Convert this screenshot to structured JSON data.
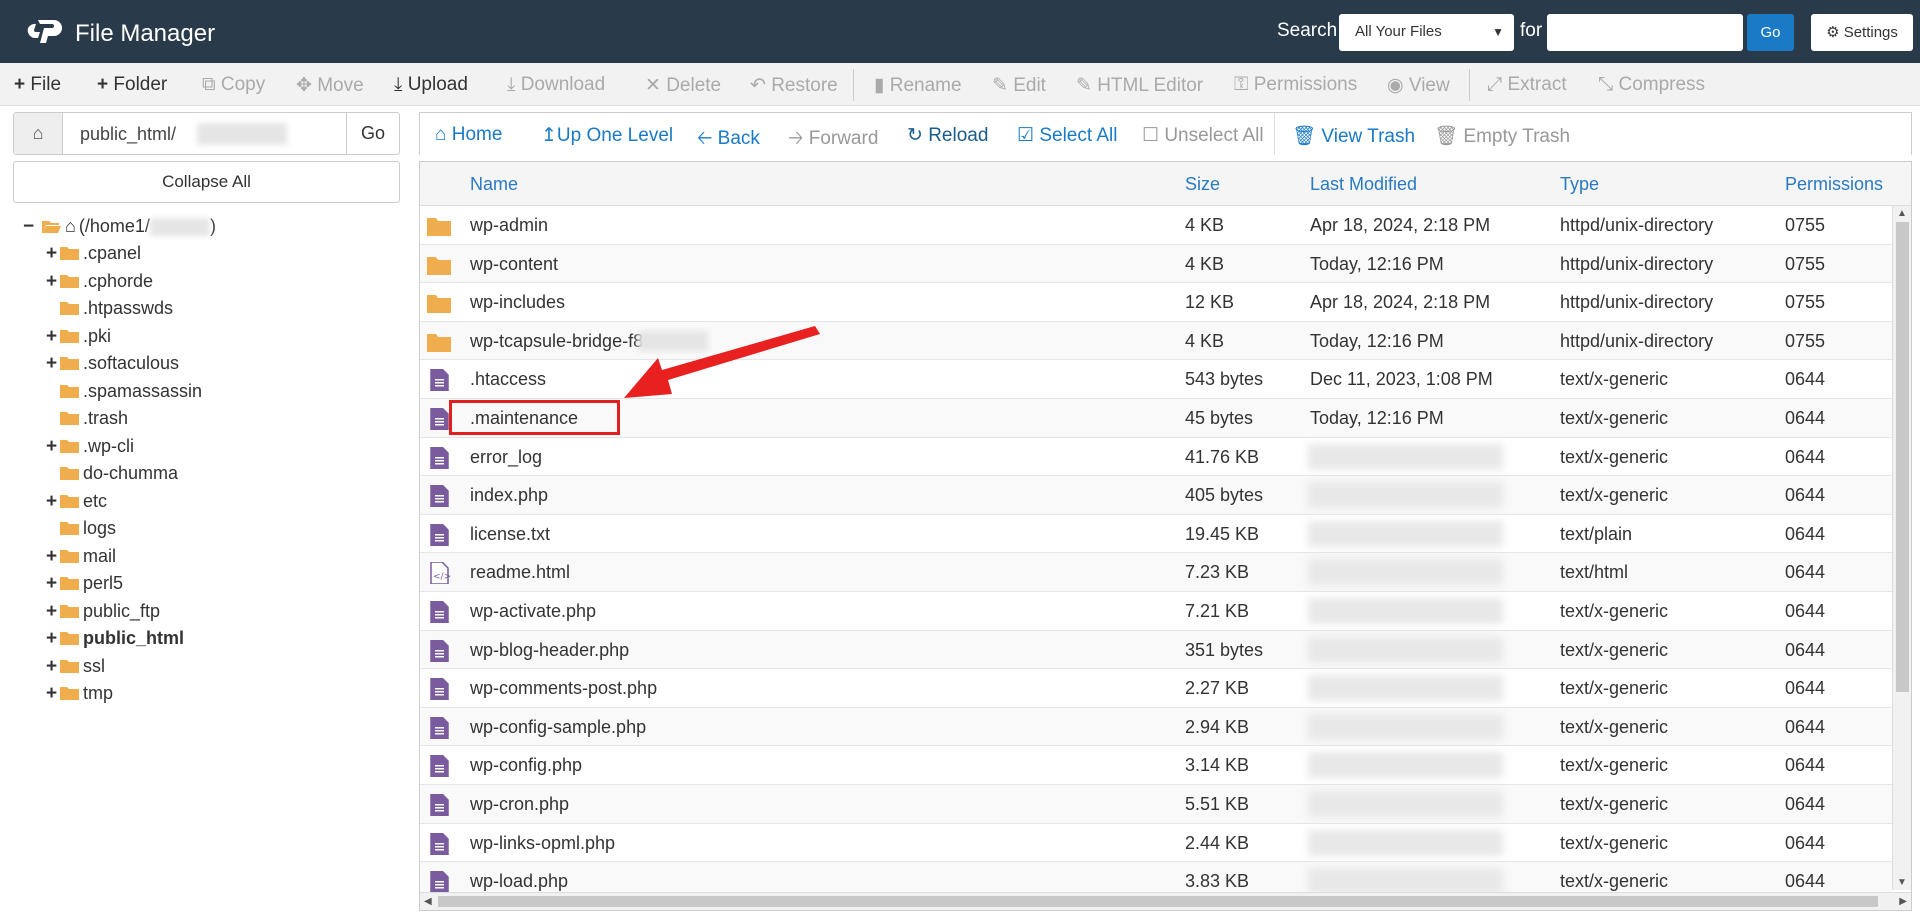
{
  "header": {
    "title": "File Manager",
    "search_label": "Search",
    "search_scope": "All Your Files",
    "for_label": "for",
    "search_value": "",
    "go_label": "Go",
    "settings_label": "Settings"
  },
  "toolbar": {
    "file": "File",
    "folder": "Folder",
    "copy": "Copy",
    "move": "Move",
    "upload": "Upload",
    "download": "Download",
    "delete": "Delete",
    "restore": "Restore",
    "rename": "Rename",
    "edit": "Edit",
    "html_editor": "HTML Editor",
    "permissions": "Permissions",
    "view": "View",
    "extract": "Extract",
    "compress": "Compress"
  },
  "sidebar": {
    "path_value": "public_html/",
    "go_label": "Go",
    "collapse_label": "Collapse All",
    "root_label_prefix": "(/home1/",
    "root_label_suffix": ")",
    "items": [
      {
        "label": ".cpanel",
        "expandable": true,
        "bold": false
      },
      {
        "label": ".cphorde",
        "expandable": true,
        "bold": false
      },
      {
        "label": ".htpasswds",
        "expandable": false,
        "bold": false
      },
      {
        "label": ".pki",
        "expandable": true,
        "bold": false
      },
      {
        "label": ".softaculous",
        "expandable": true,
        "bold": false
      },
      {
        "label": ".spamassassin",
        "expandable": false,
        "bold": false
      },
      {
        "label": ".trash",
        "expandable": false,
        "bold": false
      },
      {
        "label": ".wp-cli",
        "expandable": true,
        "bold": false
      },
      {
        "label": "do-chumma",
        "expandable": false,
        "bold": false
      },
      {
        "label": "etc",
        "expandable": true,
        "bold": false
      },
      {
        "label": "logs",
        "expandable": false,
        "bold": false
      },
      {
        "label": "mail",
        "expandable": true,
        "bold": false
      },
      {
        "label": "perl5",
        "expandable": true,
        "bold": false
      },
      {
        "label": "public_ftp",
        "expandable": true,
        "bold": false
      },
      {
        "label": "public_html",
        "expandable": true,
        "bold": true
      },
      {
        "label": "ssl",
        "expandable": true,
        "bold": false
      },
      {
        "label": "tmp",
        "expandable": true,
        "bold": false
      }
    ]
  },
  "navbar": {
    "home": "Home",
    "up_one_level": "Up One Level",
    "back": "Back",
    "forward": "Forward",
    "reload": "Reload",
    "select_all": "Select All",
    "unselect_all": "Unselect All",
    "view_trash": "View Trash",
    "empty_trash": "Empty Trash"
  },
  "table": {
    "columns": {
      "name": "Name",
      "size": "Size",
      "modified": "Last Modified",
      "type": "Type",
      "permissions": "Permissions"
    },
    "rows": [
      {
        "icon": "folder",
        "name": "wp-admin",
        "size": "4 KB",
        "modified": "Apr 18, 2024, 2:18 PM",
        "type": "httpd/unix-directory",
        "perms": "0755"
      },
      {
        "icon": "folder",
        "name": "wp-content",
        "size": "4 KB",
        "modified": "Today, 12:16 PM",
        "type": "httpd/unix-directory",
        "perms": "0755"
      },
      {
        "icon": "folder",
        "name": "wp-includes",
        "size": "12 KB",
        "modified": "Apr 18, 2024, 2:18 PM",
        "type": "httpd/unix-directory",
        "perms": "0755"
      },
      {
        "icon": "folder",
        "name": "wp-tcapsule-bridge-f8",
        "size": "4 KB",
        "modified": "Today, 12:16 PM",
        "type": "httpd/unix-directory",
        "perms": "0755"
      },
      {
        "icon": "file",
        "name": ".htaccess",
        "size": "543 bytes",
        "modified": "Dec 11, 2023, 1:08 PM",
        "type": "text/x-generic",
        "perms": "0644"
      },
      {
        "icon": "file",
        "name": ".maintenance",
        "size": "45 bytes",
        "modified": "Today, 12:16 PM",
        "type": "text/x-generic",
        "perms": "0644"
      },
      {
        "icon": "file",
        "name": "error_log",
        "size": "41.76 KB",
        "modified": "",
        "type": "text/x-generic",
        "perms": "0644"
      },
      {
        "icon": "file",
        "name": "index.php",
        "size": "405 bytes",
        "modified": "",
        "type": "text/x-generic",
        "perms": "0644"
      },
      {
        "icon": "file",
        "name": "license.txt",
        "size": "19.45 KB",
        "modified": "",
        "type": "text/plain",
        "perms": "0644"
      },
      {
        "icon": "html",
        "name": "readme.html",
        "size": "7.23 KB",
        "modified": "",
        "type": "text/html",
        "perms": "0644"
      },
      {
        "icon": "file",
        "name": "wp-activate.php",
        "size": "7.21 KB",
        "modified": "",
        "type": "text/x-generic",
        "perms": "0644"
      },
      {
        "icon": "file",
        "name": "wp-blog-header.php",
        "size": "351 bytes",
        "modified": "",
        "type": "text/x-generic",
        "perms": "0644"
      },
      {
        "icon": "file",
        "name": "wp-comments-post.php",
        "size": "2.27 KB",
        "modified": "",
        "type": "text/x-generic",
        "perms": "0644"
      },
      {
        "icon": "file",
        "name": "wp-config-sample.php",
        "size": "2.94 KB",
        "modified": "",
        "type": "text/x-generic",
        "perms": "0644"
      },
      {
        "icon": "file",
        "name": "wp-config.php",
        "size": "3.14 KB",
        "modified": "",
        "type": "text/x-generic",
        "perms": "0644"
      },
      {
        "icon": "file",
        "name": "wp-cron.php",
        "size": "5.51 KB",
        "modified": "",
        "type": "text/x-generic",
        "perms": "0644"
      },
      {
        "icon": "file",
        "name": "wp-links-opml.php",
        "size": "2.44 KB",
        "modified": "",
        "type": "text/x-generic",
        "perms": "0644"
      },
      {
        "icon": "file",
        "name": "wp-load.php",
        "size": "3.83 KB",
        "modified": "",
        "type": "text/x-generic",
        "perms": "0644"
      }
    ]
  },
  "colors": {
    "header_bg": "#293a4a",
    "link_blue": "#1b7ac6",
    "folder": "#f0ad4e",
    "file_icon": "#7a5c9e",
    "highlight": "#e02020"
  }
}
